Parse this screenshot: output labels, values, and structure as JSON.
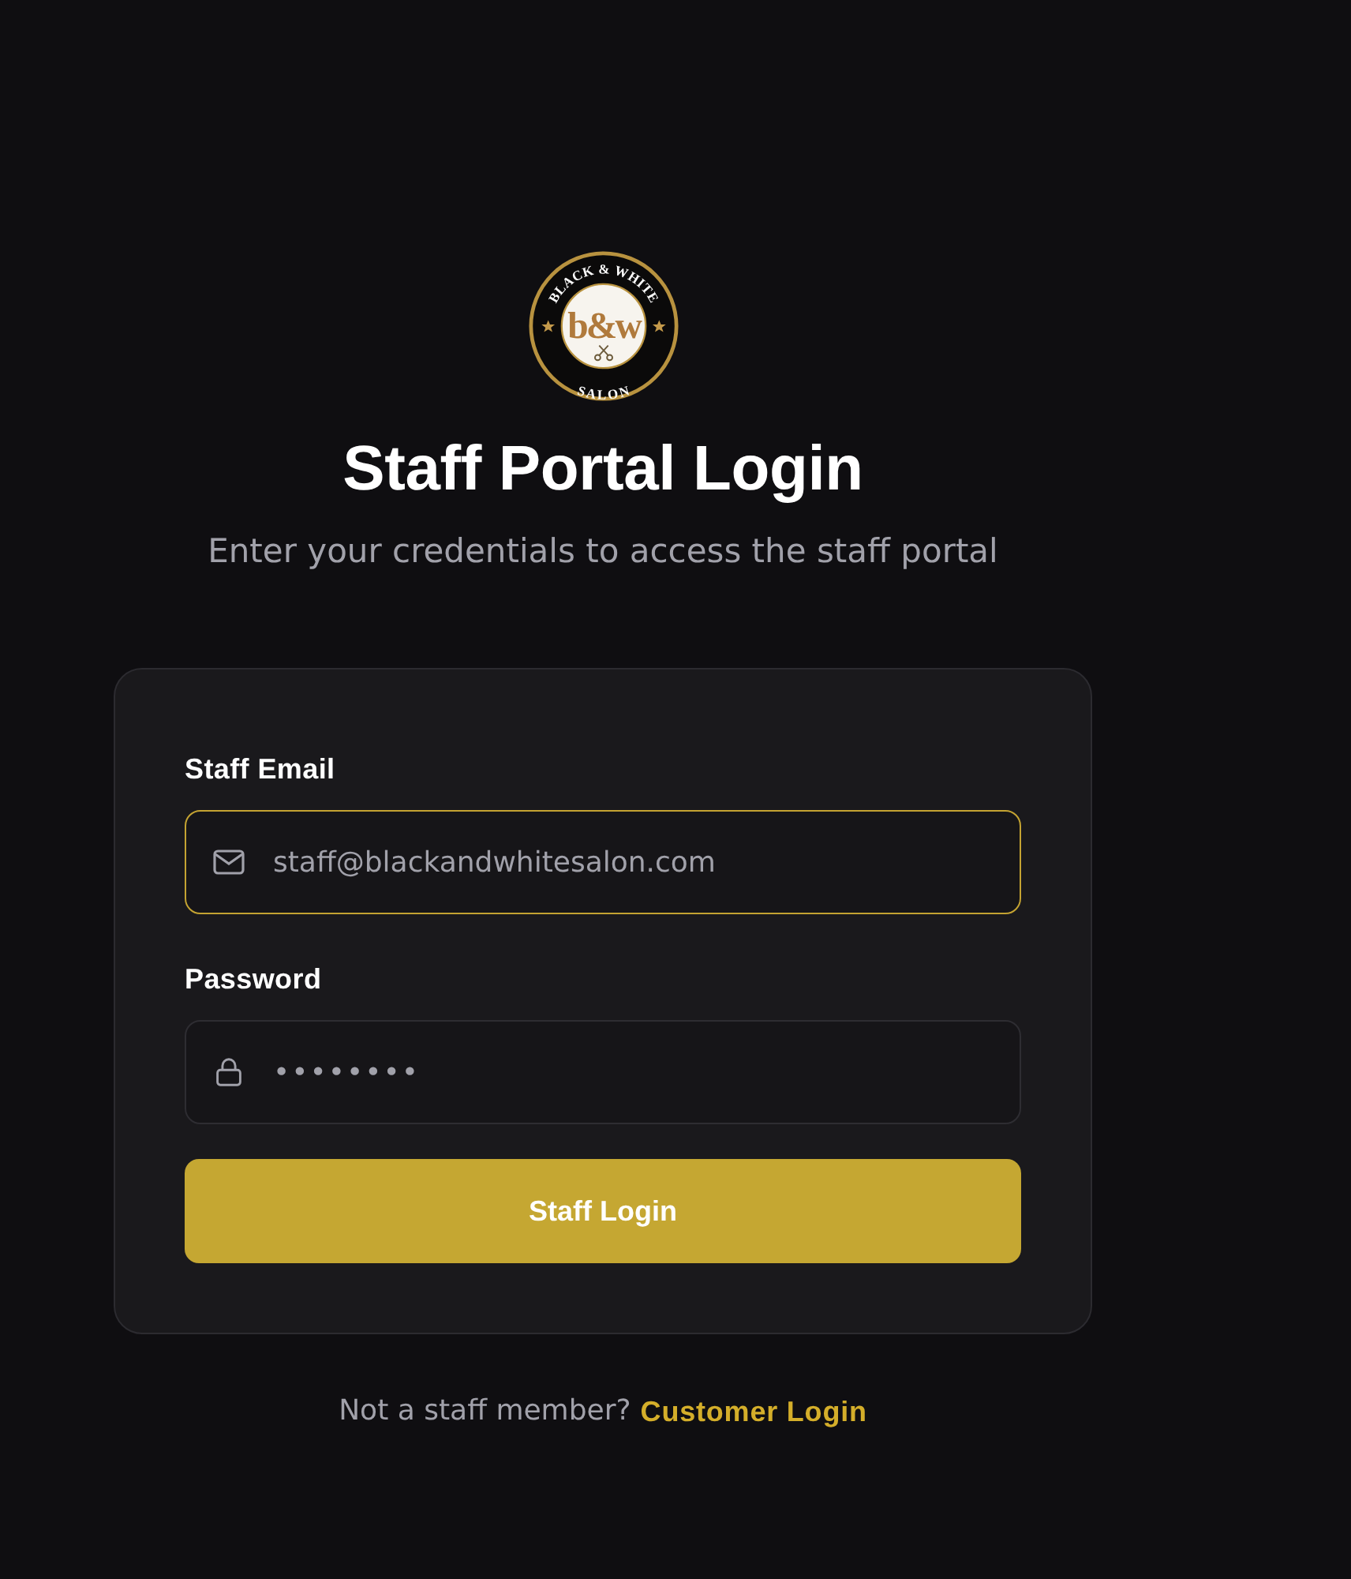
{
  "logo": {
    "top_text": "BLACK & WHITE",
    "monogram": "b&w",
    "bottom_text": "SALON"
  },
  "header": {
    "title": "Staff Portal Login",
    "subtitle": "Enter your credentials to access the staff portal"
  },
  "form": {
    "fields": [
      {
        "kind": "email",
        "label": "Staff Email",
        "placeholder": "staff@blackandwhitesalon.com",
        "focused": true
      },
      {
        "kind": "password",
        "label": "Password",
        "placeholder": "••••••••",
        "focused": false
      }
    ],
    "submit": {
      "label": "Staff Login"
    }
  },
  "footer": {
    "text": "Not a staff member?",
    "link": "Customer Login"
  }
}
